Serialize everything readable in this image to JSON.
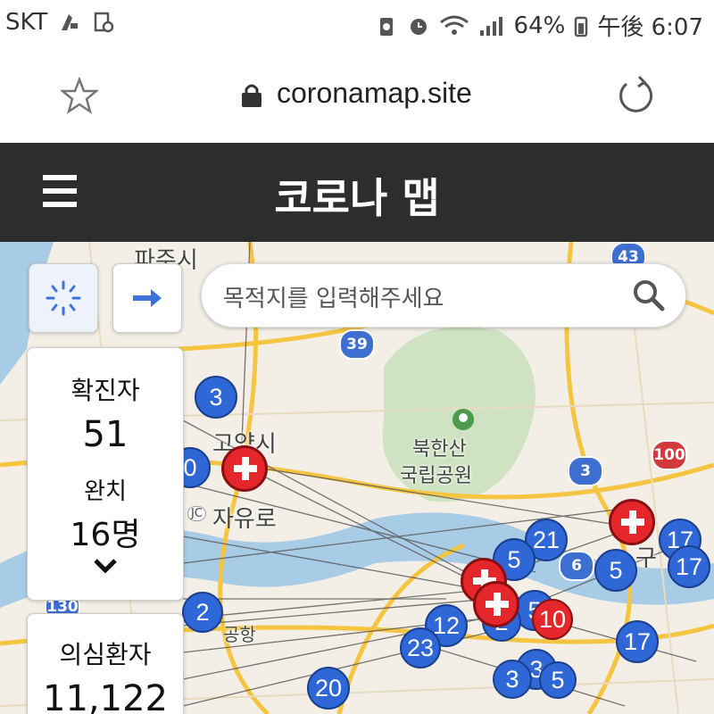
{
  "status_bar": {
    "carrier": "SKT",
    "battery": "64%",
    "time": "午後 6:07"
  },
  "browser": {
    "url": "coronamap.site"
  },
  "app": {
    "title": "코로나 맵"
  },
  "search": {
    "placeholder": "목적지를 입력해주세요"
  },
  "stats": {
    "confirmed_label": "확진자",
    "confirmed_value": "51",
    "recovered_label": "완치",
    "recovered_value": "16명",
    "suspected_label": "의심환자",
    "suspected_value": "11,122"
  },
  "map_labels": {
    "paju": "파주시",
    "goyang": "고양시",
    "jayuro": "자유로",
    "jc": "JC",
    "bukhansan_1": "북한산",
    "bukhansan_2": "국립공원",
    "airport": "공항",
    "guri": "구"
  },
  "road_numbers": [
    "39",
    "3",
    "100",
    "43",
    "130",
    "6"
  ],
  "clusters": [
    "3",
    "0",
    "21",
    "5",
    "17",
    "17",
    "5",
    "5",
    "2",
    "12",
    "23",
    "20",
    "3",
    "17",
    "2",
    "10",
    "3",
    "5"
  ],
  "colors": {
    "header_bg": "#2d2d2d",
    "cluster_blue": "#2f67d6",
    "hospital_red": "#e5262a",
    "accent_blue": "#3a73d9"
  }
}
